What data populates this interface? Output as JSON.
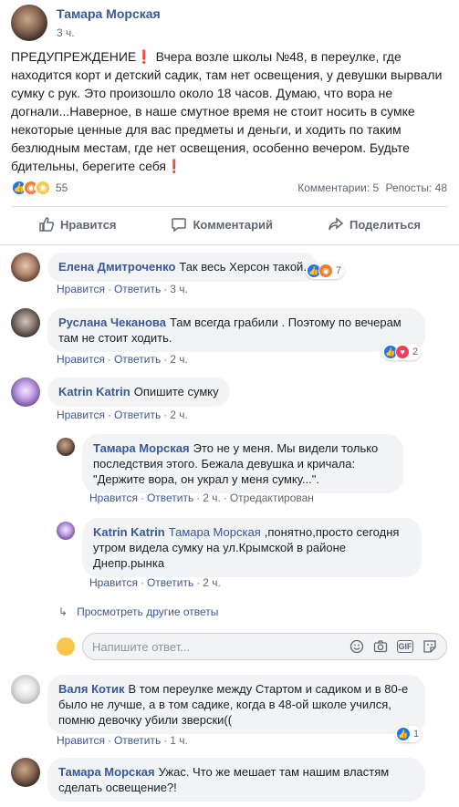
{
  "post": {
    "author": "Тамара Морская",
    "time": "3 ч.",
    "text": "ПРЕДУПРЕЖДЕНИЕ❗ Вчера возле школы №48, в переулке, где находится корт и детский садик, там нет освещения, у девушки вырвали сумку с рук. Это произошло около 18 часов. Думаю, что вора не догнали...Наверное, в наше смутное время не стоит носить в сумке некоторые ценные для вас предметы и деньги, и ходить по таким безлюдным местам, где нет освещения, особенно вечером. Будьте бдительны, берегите себя❗",
    "reaction_count": "55",
    "comments_label": "Комментарии: 5",
    "reposts_label": "Репосты: 48"
  },
  "actions": {
    "like": "Нравится",
    "comment": "Комментарий",
    "share": "Поделиться"
  },
  "comment_meta": {
    "like": "Нравится",
    "reply": "Ответить",
    "edited": "Отредактирован"
  },
  "comments": [
    {
      "name": "Елена Дмитроченко",
      "text": "Так весь Херсон такой.",
      "time": "3 ч.",
      "reactions": "7",
      "reaction_icons": [
        "like",
        "angry"
      ]
    },
    {
      "name": "Руслана Чеканова",
      "text": "Там всегда грабили . Поэтому по вечерам там не стоит ходить.",
      "time": "2 ч.",
      "reactions": "2",
      "reaction_icons": [
        "like",
        "heart"
      ]
    },
    {
      "name": "Katrin Katrin",
      "text": "Опишите сумку",
      "time": "2 ч."
    },
    {
      "name": "Тамара Морская",
      "text": "Это не у меня. Мы видели только последствия этого. Бежала девушка и кричала: \"Держите вора, он украл у меня сумку...\".",
      "time": "2 ч."
    },
    {
      "name": "Katrin Katrin",
      "mention": "Тамара Морская",
      "text": ",понятно,просто сегодня утром видела сумку на ул.Крымской в районе Днепр.рынка",
      "time": "2 ч."
    },
    {
      "name": "Валя Котик",
      "text": "В том переулке между Стартом и садиком и в 80-е было не лучше, а в том садике, когда в 48-ой школе учился, помню девочку убили зверски((",
      "time": "1 ч.",
      "reactions": "1",
      "reaction_icons": [
        "like"
      ]
    },
    {
      "name": "Тамара Морская",
      "text": "Ужас. Что же мешает там нашим властям сделать освещение?!"
    }
  ],
  "see_more_replies": "Просмотреть другие ответы",
  "reply_placeholder": "Напишите ответ...",
  "reply_icons": [
    "emoji-icon",
    "camera-icon",
    "gif-icon",
    "sticker-icon"
  ],
  "colors": {
    "link": "#385898",
    "like_blue": "#1877f2",
    "angry_orange": "#f27c2c",
    "heart_red": "#f33e58",
    "bubble": "#f2f3f5"
  }
}
